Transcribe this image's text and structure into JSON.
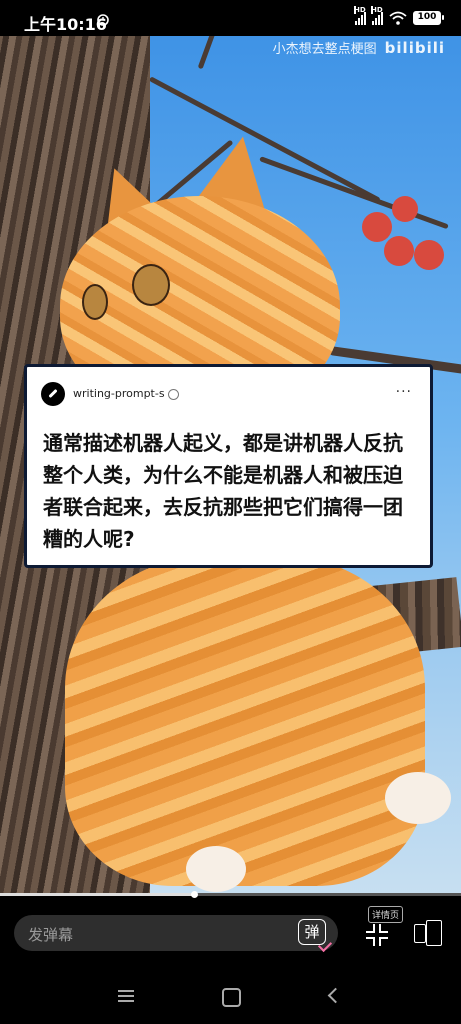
{
  "status_bar": {
    "time": "上午10:16",
    "signal_label": "HD",
    "battery": "100"
  },
  "video": {
    "watermark_text": "小杰想去整点梗图",
    "watermark_logo": "bilibili",
    "progress_fraction": 0.42
  },
  "card": {
    "username": "writing-prompt-s",
    "more": "···",
    "body": "通常描述机器人起义，都是讲机器人反抗整个人类，为什么不能是机器人和被压迫者联合起来，去反抗那些把它们搞得一团糟的人呢?"
  },
  "controls": {
    "danmaku_placeholder": "发弹幕",
    "danmaku_button": "弹",
    "detail_tag": "详情页"
  },
  "icons": {
    "alarm": "alarm-icon",
    "wifi": "wifi-icon",
    "expand": "fullscreen-exit-icon",
    "device": "device-switch-icon"
  }
}
